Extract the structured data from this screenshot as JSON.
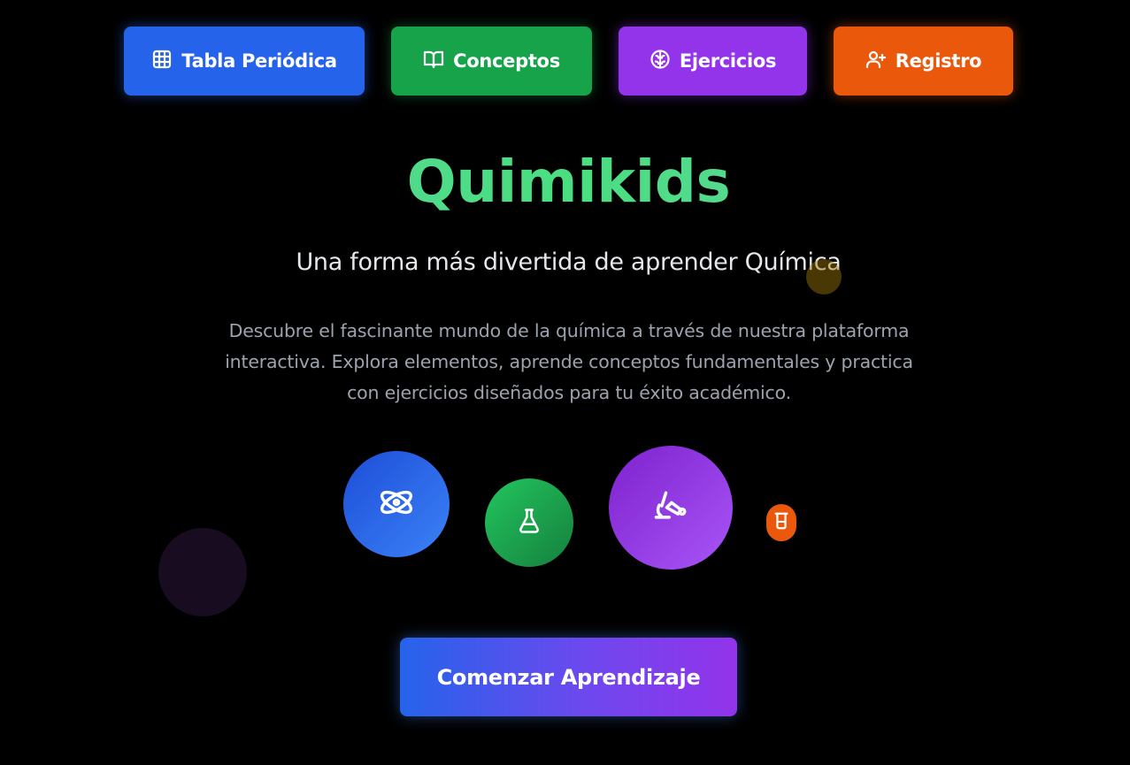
{
  "nav": {
    "items": [
      {
        "label": "Tabla Periódica",
        "icon": "grid-icon",
        "color": "#2563eb"
      },
      {
        "label": "Conceptos",
        "icon": "book-open-icon",
        "color": "#16a34a"
      },
      {
        "label": "Ejercicios",
        "icon": "brain-icon",
        "color": "#9333ea"
      },
      {
        "label": "Registro",
        "icon": "user-plus-icon",
        "color": "#ea580c"
      }
    ]
  },
  "hero": {
    "title": "Quimikids",
    "subtitle": "Una forma más divertida de aprender Química",
    "description": "Descubre el fascinante mundo de la química a través de nuestra plataforma interactiva. Explora elementos, aprende conceptos fundamentales y practica con ejercicios diseñados para tu éxito académico."
  },
  "features": [
    {
      "icon": "atom-icon",
      "color": "#3b82f6"
    },
    {
      "icon": "flask-icon",
      "color": "#22c55e"
    },
    {
      "icon": "microscope-icon",
      "color": "#a855f7"
    },
    {
      "icon": "beaker-icon",
      "color": "#ea580c"
    }
  ],
  "cta": {
    "label": "Comenzar Aprendizaje"
  },
  "colors": {
    "background": "#000000",
    "title_gradient": [
      "#5ed3a8",
      "#4ade80"
    ],
    "cta_gradient": [
      "#2563eb",
      "#9333ea"
    ]
  }
}
